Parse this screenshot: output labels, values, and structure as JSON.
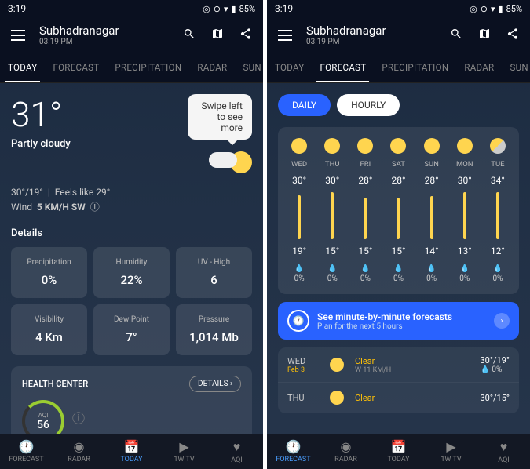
{
  "status": {
    "time": "3:19",
    "battery": "85%"
  },
  "header": {
    "location": "Subhadranagar",
    "time": "03:19 PM"
  },
  "tabs": [
    "TODAY",
    "FORECAST",
    "PRECIPITATION",
    "RADAR",
    "SUN &"
  ],
  "today": {
    "temp": "31°",
    "condition": "Partly cloudy",
    "tip": "Swipe left to see more",
    "hilo": "30°/19°",
    "feels_label": "Feels like",
    "feels": "29°",
    "wind_label": "Wind",
    "wind": "5 KM/H SW",
    "details_title": "Details",
    "cards": [
      {
        "label": "Precipitation",
        "value": "0%"
      },
      {
        "label": "Humidity",
        "value": "22%"
      },
      {
        "label": "UV - High",
        "value": "6"
      },
      {
        "label": "Visibility",
        "value": "4 Km"
      },
      {
        "label": "Dew Point",
        "value": "7°"
      },
      {
        "label": "Pressure",
        "value": "1,014 Mb"
      }
    ],
    "health": {
      "title": "HEALTH CENTER",
      "details": "DETAILS",
      "aqi_label": "AQI",
      "aqi": "56"
    }
  },
  "forecast": {
    "toggle": {
      "daily": "DAILY",
      "hourly": "HOURLY"
    },
    "days": [
      {
        "name": "WED",
        "hi": "30°",
        "lo": "19°",
        "precip": "0%",
        "bar": 56
      },
      {
        "name": "THU",
        "hi": "30°",
        "lo": "15°",
        "precip": "0%",
        "bar": 60
      },
      {
        "name": "FRI",
        "hi": "28°",
        "lo": "15°",
        "precip": "0%",
        "bar": 53
      },
      {
        "name": "SAT",
        "hi": "28°",
        "lo": "15°",
        "precip": "0%",
        "bar": 53
      },
      {
        "name": "SUN",
        "hi": "28°",
        "lo": "14°",
        "precip": "0%",
        "bar": 55
      },
      {
        "name": "MON",
        "hi": "30°",
        "lo": "13°",
        "precip": "0%",
        "bar": 60
      },
      {
        "name": "TUE",
        "hi": "34°",
        "lo": "12°",
        "precip": "0%",
        "bar": 60
      }
    ],
    "minute": {
      "title": "See minute-by-minute forecasts",
      "sub": "Plan for the next 5 hours"
    },
    "list": [
      {
        "day": "WED",
        "date": "Feb 3",
        "cond": "Clear",
        "wind": "W 11 KM/H",
        "temp": "30°/19°",
        "precip": "0%"
      },
      {
        "day": "THU",
        "date": "",
        "cond": "Clear",
        "wind": "",
        "temp": "30°/15°",
        "precip": ""
      }
    ]
  },
  "nav": [
    "FORECAST",
    "RADAR",
    "TODAY",
    "1W TV",
    "AQI"
  ]
}
